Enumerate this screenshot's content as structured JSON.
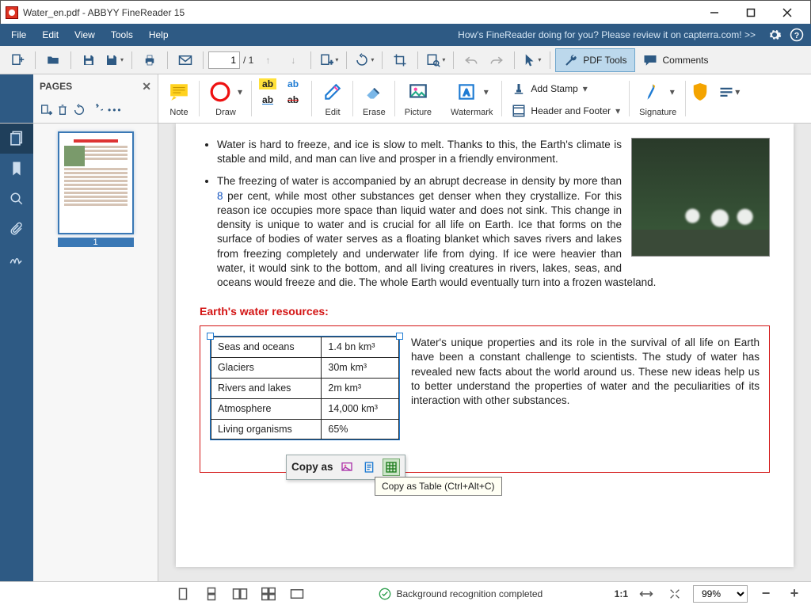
{
  "window": {
    "title": "Water_en.pdf - ABBYY FineReader 15"
  },
  "menu": {
    "items": [
      "File",
      "Edit",
      "View",
      "Tools",
      "Help"
    ],
    "promo": "How's FineReader doing for you? Please review it on capterra.com! >>"
  },
  "toolbar": {
    "page_current": "1",
    "page_total": "/ 1",
    "pdf_tools": "PDF Tools",
    "comments": "Comments"
  },
  "editbar": {
    "note": "Note",
    "draw": "Draw",
    "edit": "Edit",
    "erase": "Erase",
    "picture": "Picture",
    "watermark": "Watermark",
    "add_stamp": "Add Stamp",
    "header_footer": "Header and Footer",
    "signature": "Signature"
  },
  "pages": {
    "title": "PAGES",
    "thumb_num": "1"
  },
  "doc": {
    "bullet1": "Water is hard to freeze, and ice is slow to melt. Thanks to this, the Earth's climate is stable and mild, and man can live and prosper in a friendly environment.",
    "bullet2a": "The freezing of water is accompanied by an abrupt decrease in density by more than ",
    "bullet2a_num": "8",
    "bullet2b": " per cent, while most other substances get denser when they crystallize. For this reason ice occupies more space than liquid water and does not sink. This change in density is unique to water and is crucial for all life on Earth. Ice that forms on the surface of bodies of water serves as a floating blanket which saves rivers and lakes from freezing completely and underwater life from dying. If ice were heavier than water, it would sink to the bottom, and all living creatures in rivers, lakes, seas, and oceans would freeze and die. The whole Earth would eventually turn into a frozen wasteland.",
    "red_head": "Earth's water resources:",
    "table": {
      "rows": [
        [
          "Seas and oceans",
          "1.4 bn km³"
        ],
        [
          "Glaciers",
          "30m km³"
        ],
        [
          "Rivers and lakes",
          "2m km³"
        ],
        [
          "Atmosphere",
          "14,000 km³"
        ],
        [
          "Living organisms",
          "65%"
        ]
      ]
    },
    "side_para": "Water's unique properties and its role in the survival of all life on Earth have been a constant challenge to scientists. The study of water has revealed new facts about the world around us. These new ideas help us to better understand the properties of water and the peculiarities of its interaction with other substances.",
    "copy_as": "Copy as",
    "tooltip": "Copy as Table (Ctrl+Alt+C)"
  },
  "status": {
    "msg": "Background recognition completed",
    "ratio": "1:1",
    "zoom": "99%"
  }
}
